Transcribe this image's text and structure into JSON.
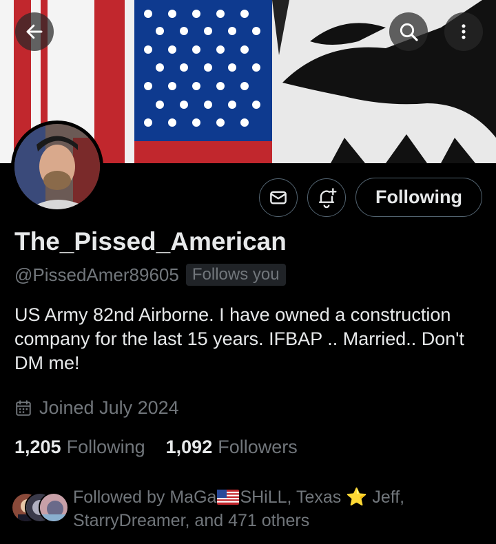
{
  "header": {
    "back_icon": "arrow-left-icon",
    "search_icon": "search-icon",
    "more_icon": "more-vertical-icon"
  },
  "profile": {
    "display_name": "The_Pissed_American",
    "handle": "@PissedAmer89605",
    "follows_you": "Follows you",
    "bio": "US Army 82nd Airborne. I have owned a construction company for the last 15 years. IFBAP .. Married.. Don't DM me!",
    "joined": "Joined July 2024"
  },
  "actions": {
    "message_icon": "envelope-icon",
    "notify_icon": "bell-plus-icon",
    "following_label": "Following"
  },
  "stats": {
    "following_count": "1,205",
    "following_label": "Following",
    "followers_count": "1,092",
    "followers_label": "Followers"
  },
  "followed_by": {
    "prefix": "Followed by MaGa",
    "name1_rest": "SHiLL, Texas ",
    "star": "⭐",
    "after_star": " Jeff,",
    "line2": "StarryDreamer, and 471 others"
  },
  "colors": {
    "background": "#000000",
    "text_primary": "#e7e9ea",
    "text_secondary": "#71767b",
    "border": "#536471",
    "star": "#f5c518"
  }
}
